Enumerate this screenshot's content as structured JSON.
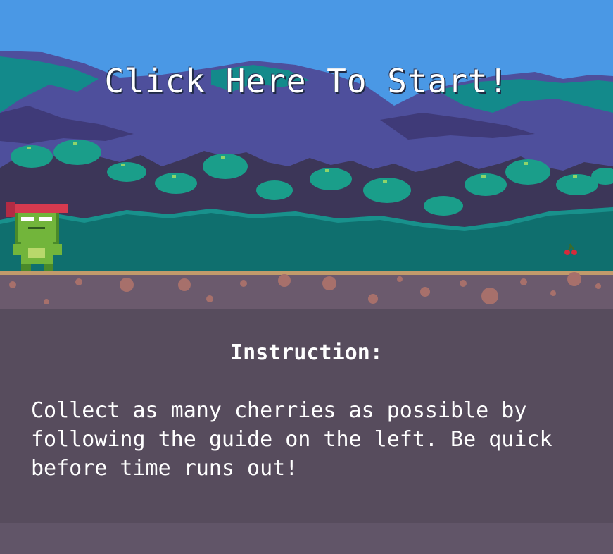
{
  "start_label": "Click Here To Start!",
  "instruction": {
    "title": "Instruction:",
    "text": "Collect as many cherries as possible by following the guide on the left. Be quick before time runs out!"
  },
  "colors": {
    "sky": "#4a98e5",
    "mountain_far": "#4e4f9c",
    "mountain_teal": "#138a8b",
    "tree_dark": "#3c3658",
    "foliage": "#1a9e8a",
    "grass": "#0f6f6e",
    "ground_top": "#c19a6b",
    "dirt": "#6b5a6d",
    "panel": "#574c5d"
  },
  "sprites": {
    "player": "frog-ninja-icon",
    "collectible": "cherry-icon"
  }
}
